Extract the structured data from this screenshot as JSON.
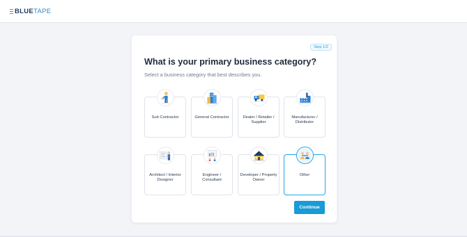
{
  "brand": {
    "logo_bold": "BLUE",
    "logo_light": "TAPE",
    "accent": "#1a9ad6"
  },
  "step": {
    "label": "Step 1/2"
  },
  "question": {
    "title": "What is your primary business category?",
    "subtitle": "Select a business category that best describes you."
  },
  "categories": [
    {
      "label": "Sub Contractor",
      "icon": "worker-icon",
      "selected": false
    },
    {
      "label": "General Contractor",
      "icon": "buildings-icon",
      "selected": false
    },
    {
      "label": "Dealer / Retailer / Supplier",
      "icon": "truck-icon",
      "selected": false
    },
    {
      "label": "Manufacturer / Distributor",
      "icon": "factory-icon",
      "selected": false
    },
    {
      "label": "Architect / Interior Designer",
      "icon": "blueprint-icon",
      "selected": false
    },
    {
      "label": "Engineer / Consultant",
      "icon": "chart-icon",
      "selected": false
    },
    {
      "label": "Developer / Property Owner",
      "icon": "house-icon",
      "selected": false
    },
    {
      "label": "Other",
      "icon": "people-icon",
      "selected": true
    }
  ],
  "actions": {
    "continue_label": "Continue"
  }
}
